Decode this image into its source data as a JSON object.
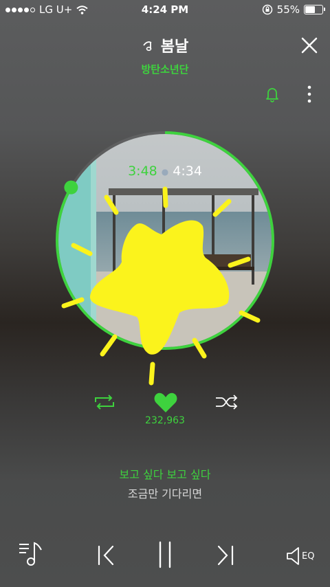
{
  "status_bar": {
    "carrier": "LG U+",
    "time": "4:24 PM",
    "battery": "55%"
  },
  "song": {
    "title": "봄날",
    "artist": "방탄소년단",
    "current_time": "3:48",
    "total_time": "4:34",
    "progress": 0.832
  },
  "likes": "232,963",
  "lyrics": {
    "current": "보고 싶다 보고 싶다",
    "next": "조금만 기다리면"
  },
  "playback": {
    "state": "playing",
    "repeat": "on",
    "shuffle": "off"
  },
  "bottom_bar": {
    "eq_label": "EQ"
  },
  "colors": {
    "accent": "#3ed23e",
    "star": "#fbf31c"
  },
  "icons": [
    "signal-dots-icon",
    "wifi-icon",
    "rotation-lock-icon",
    "battery-icon",
    "music-note-icon",
    "close-icon",
    "bell-icon",
    "more-icon",
    "repeat-icon",
    "heart-icon",
    "shuffle-icon",
    "playlist-icon",
    "previous-icon",
    "pause-icon",
    "next-icon",
    "eq-icon",
    "star-sticker"
  ]
}
